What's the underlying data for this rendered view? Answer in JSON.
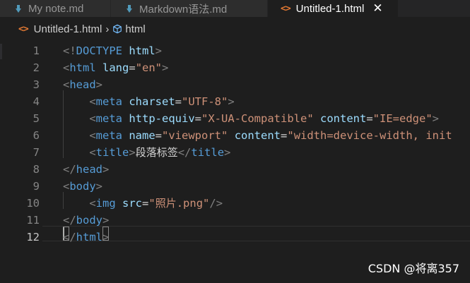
{
  "tabs": [
    {
      "label": "My note.md",
      "icon": "markdown-icon"
    },
    {
      "label": "Markdown语法.md",
      "icon": "markdown-icon"
    },
    {
      "label": "Untitled-1.html",
      "icon": "html-icon",
      "active": true,
      "close": "✕"
    }
  ],
  "breadcrumb": {
    "file": "Untitled-1.html",
    "separator": "›",
    "element": "html",
    "html_glyph": "<>"
  },
  "editor": {
    "active_line": 12,
    "line_numbers": [
      "1",
      "2",
      "3",
      "4",
      "5",
      "6",
      "7",
      "8",
      "9",
      "10",
      "11",
      "12"
    ],
    "lines": [
      [
        {
          "t": "punc",
          "v": "<!"
        },
        {
          "t": "tag",
          "v": "DOCTYPE"
        },
        {
          "t": "text",
          "v": " "
        },
        {
          "t": "attr",
          "v": "html"
        },
        {
          "t": "punc",
          "v": ">"
        }
      ],
      [
        {
          "t": "punc",
          "v": "<"
        },
        {
          "t": "tag",
          "v": "html"
        },
        {
          "t": "text",
          "v": " "
        },
        {
          "t": "attr",
          "v": "lang"
        },
        {
          "t": "text",
          "v": "="
        },
        {
          "t": "str",
          "v": "\"en\""
        },
        {
          "t": "punc",
          "v": ">"
        }
      ],
      [
        {
          "t": "punc",
          "v": "<"
        },
        {
          "t": "tag",
          "v": "head"
        },
        {
          "t": "punc",
          "v": ">"
        }
      ],
      [
        {
          "t": "text",
          "v": "    "
        },
        {
          "t": "punc",
          "v": "<"
        },
        {
          "t": "tag",
          "v": "meta"
        },
        {
          "t": "text",
          "v": " "
        },
        {
          "t": "attr",
          "v": "charset"
        },
        {
          "t": "text",
          "v": "="
        },
        {
          "t": "str",
          "v": "\"UTF-8\""
        },
        {
          "t": "punc",
          "v": ">"
        }
      ],
      [
        {
          "t": "text",
          "v": "    "
        },
        {
          "t": "punc",
          "v": "<"
        },
        {
          "t": "tag",
          "v": "meta"
        },
        {
          "t": "text",
          "v": " "
        },
        {
          "t": "attr",
          "v": "http-equiv"
        },
        {
          "t": "text",
          "v": "="
        },
        {
          "t": "str",
          "v": "\"X-UA-Compatible\""
        },
        {
          "t": "text",
          "v": " "
        },
        {
          "t": "attr",
          "v": "content"
        },
        {
          "t": "text",
          "v": "="
        },
        {
          "t": "str",
          "v": "\"IE=edge\""
        },
        {
          "t": "punc",
          "v": ">"
        }
      ],
      [
        {
          "t": "text",
          "v": "    "
        },
        {
          "t": "punc",
          "v": "<"
        },
        {
          "t": "tag",
          "v": "meta"
        },
        {
          "t": "text",
          "v": " "
        },
        {
          "t": "attr",
          "v": "name"
        },
        {
          "t": "text",
          "v": "="
        },
        {
          "t": "str",
          "v": "\"viewport\""
        },
        {
          "t": "text",
          "v": " "
        },
        {
          "t": "attr",
          "v": "content"
        },
        {
          "t": "text",
          "v": "="
        },
        {
          "t": "str",
          "v": "\"width=device-width, init"
        }
      ],
      [
        {
          "t": "text",
          "v": "    "
        },
        {
          "t": "punc",
          "v": "<"
        },
        {
          "t": "tag",
          "v": "title"
        },
        {
          "t": "punc",
          "v": ">"
        },
        {
          "t": "cn",
          "v": "段落标签"
        },
        {
          "t": "punc",
          "v": "</"
        },
        {
          "t": "tag",
          "v": "title"
        },
        {
          "t": "punc",
          "v": ">"
        }
      ],
      [
        {
          "t": "punc",
          "v": "</"
        },
        {
          "t": "tag",
          "v": "head"
        },
        {
          "t": "punc",
          "v": ">"
        }
      ],
      [
        {
          "t": "punc",
          "v": "<"
        },
        {
          "t": "tag",
          "v": "body"
        },
        {
          "t": "punc",
          "v": ">"
        }
      ],
      [
        {
          "t": "text",
          "v": "    "
        },
        {
          "t": "punc",
          "v": "<"
        },
        {
          "t": "tag",
          "v": "img"
        },
        {
          "t": "text",
          "v": " "
        },
        {
          "t": "attr",
          "v": "src"
        },
        {
          "t": "text",
          "v": "="
        },
        {
          "t": "str",
          "v": "\""
        },
        {
          "t": "strcn",
          "v": "照片"
        },
        {
          "t": "str",
          "v": ".png\""
        },
        {
          "t": "punc",
          "v": "/>"
        }
      ],
      [
        {
          "t": "punc",
          "v": "</"
        },
        {
          "t": "tag",
          "v": "body"
        },
        {
          "t": "punc",
          "v": ">"
        }
      ],
      [
        {
          "t": "punc",
          "v": "</"
        },
        {
          "t": "tag",
          "v": "html"
        },
        {
          "t": "punc",
          "v": ">"
        }
      ]
    ]
  },
  "watermark": "CSDN @将离357",
  "colors": {
    "background": "#1e1e1e",
    "tag": "#569cd6",
    "attribute": "#9cdcfe",
    "string": "#ce9178",
    "punctuation": "#808080",
    "html_icon": "#e37933",
    "markdown_icon": "#519aba"
  }
}
